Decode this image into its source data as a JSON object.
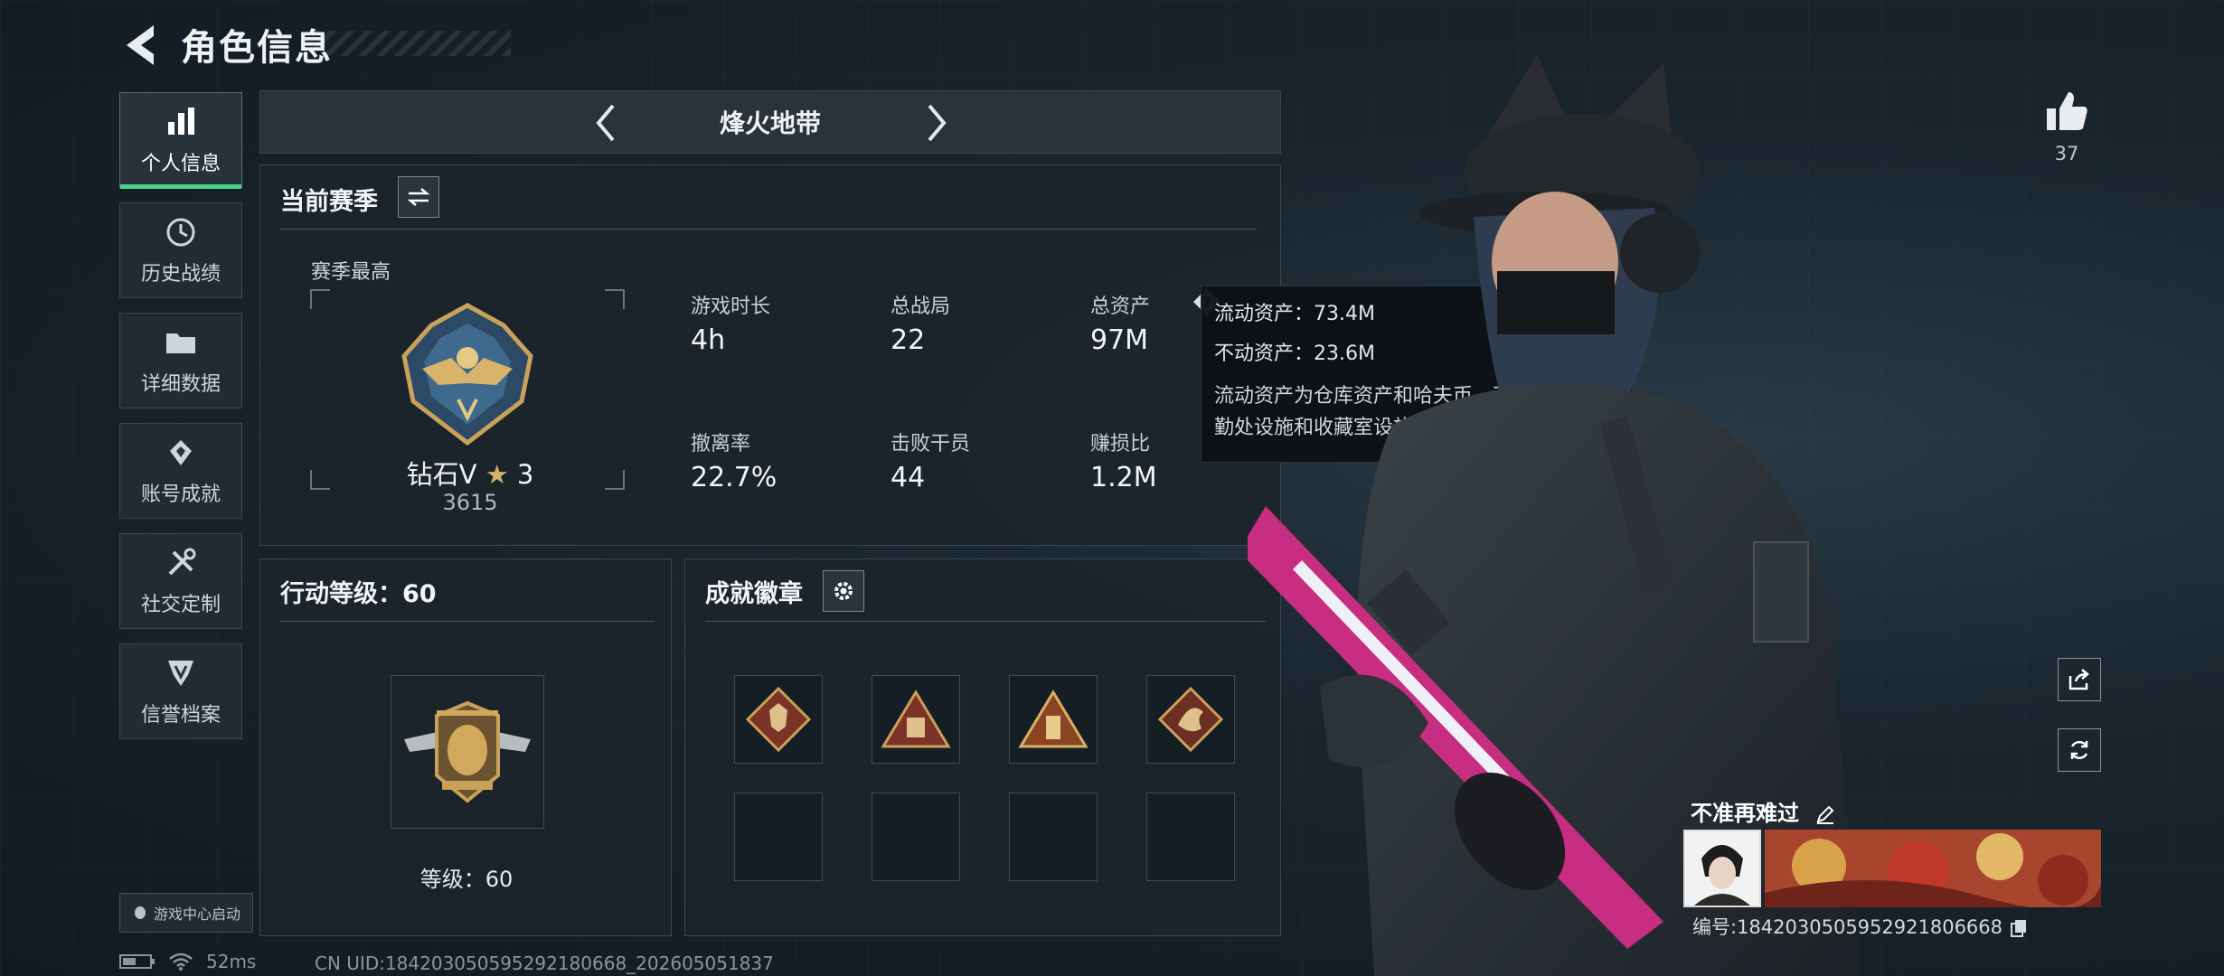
{
  "header": {
    "title": "角色信息"
  },
  "nav": {
    "items": [
      {
        "label": "个人信息",
        "icon": "bar-chart-icon"
      },
      {
        "label": "历史战绩",
        "icon": "history-icon"
      },
      {
        "label": "详细数据",
        "icon": "folder-icon"
      },
      {
        "label": "账号成就",
        "icon": "achievement-icon"
      },
      {
        "label": "社交定制",
        "icon": "tools-icon"
      },
      {
        "label": "信誉档案",
        "icon": "shield-icon"
      }
    ],
    "game_center_label": "游戏中心启动"
  },
  "mode": {
    "name": "烽火地带"
  },
  "season": {
    "title": "当前赛季",
    "best_label": "赛季最高",
    "rank_name": "钻石V",
    "rank_stars": "3",
    "rank_score": "3615",
    "stats": [
      {
        "label": "游戏时长",
        "value": "4h"
      },
      {
        "label": "总战局",
        "value": "22"
      },
      {
        "label": "总资产",
        "value": "97M"
      },
      {
        "label": "撤离率",
        "value": "22.7%"
      },
      {
        "label": "击败干员",
        "value": "44"
      },
      {
        "label": "赚损比",
        "value": "1.2M"
      }
    ]
  },
  "tooltip": {
    "liquid": "流动资产：73.4M",
    "fixed": "不动资产：23.6M",
    "desc": "流动资产为仓库资产和哈夫币，不动资产为特勤处设施和收藏室设施"
  },
  "level": {
    "title": "行动等级：60",
    "label": "等级：60"
  },
  "badges": {
    "title": "成就徽章"
  },
  "right": {
    "likes": "37"
  },
  "player": {
    "name": "不准再难过",
    "id": "编号:1842030505952921806668"
  },
  "status": {
    "ping": "52ms",
    "uid": "CN UID:184203050595292180668_202605051837"
  },
  "colors": {
    "accent": "#47d18b",
    "panel_bg": "#1c242b",
    "badge_gold": "#c9a15a",
    "badge_red": "#b8553a"
  }
}
